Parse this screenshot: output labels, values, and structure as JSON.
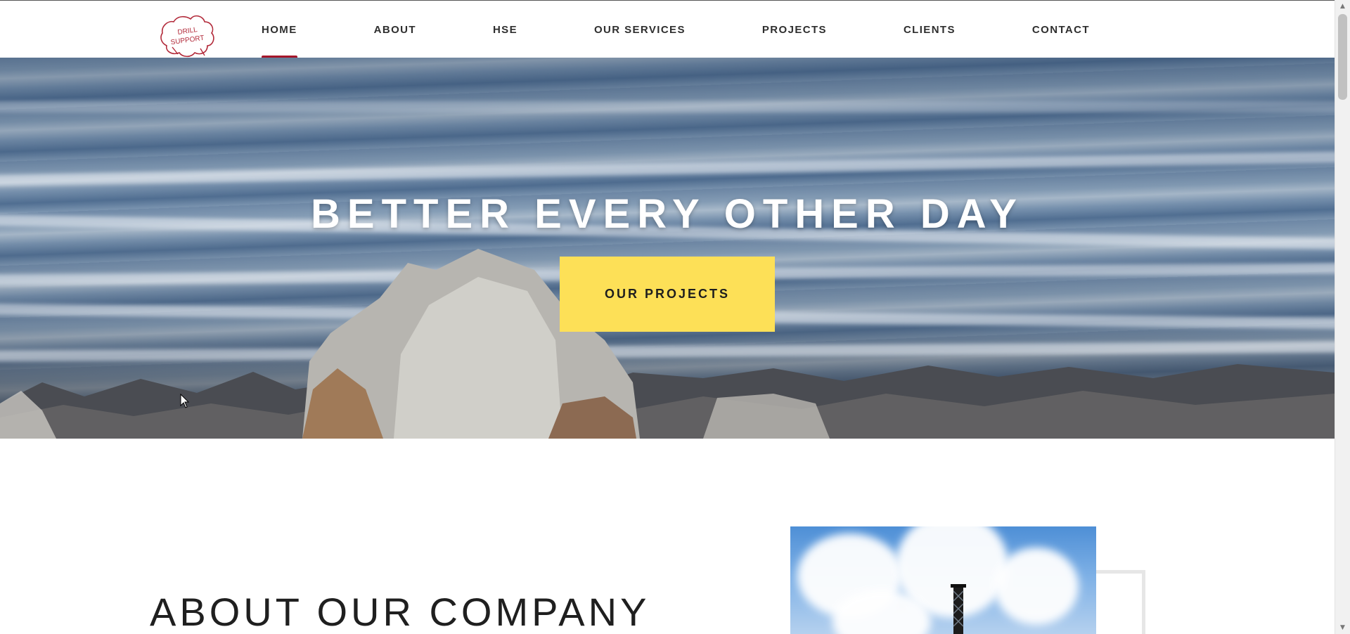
{
  "header": {
    "logo_text": [
      "DRILL",
      "SUPPORT"
    ],
    "nav": [
      {
        "label": "HOME",
        "active": true
      },
      {
        "label": "ABOUT",
        "active": false
      },
      {
        "label": "HSE",
        "active": false
      },
      {
        "label": "OUR SERVICES",
        "active": false
      },
      {
        "label": "PROJECTS",
        "active": false
      },
      {
        "label": "CLIENTS",
        "active": false
      },
      {
        "label": "CONTACT",
        "active": false
      }
    ]
  },
  "hero": {
    "title": "BETTER EVERY OTHER DAY",
    "button_label": "OUR PROJECTS"
  },
  "about": {
    "title": "ABOUT OUR COMPANY"
  },
  "colors": {
    "accent_active": "#a5162a",
    "button": "#fde057",
    "logo": "#b22a3a"
  },
  "icons": {
    "cursor": "arrow-cursor-icon",
    "scroll_up": "triangle-up-icon",
    "scroll_down": "triangle-down-icon"
  }
}
